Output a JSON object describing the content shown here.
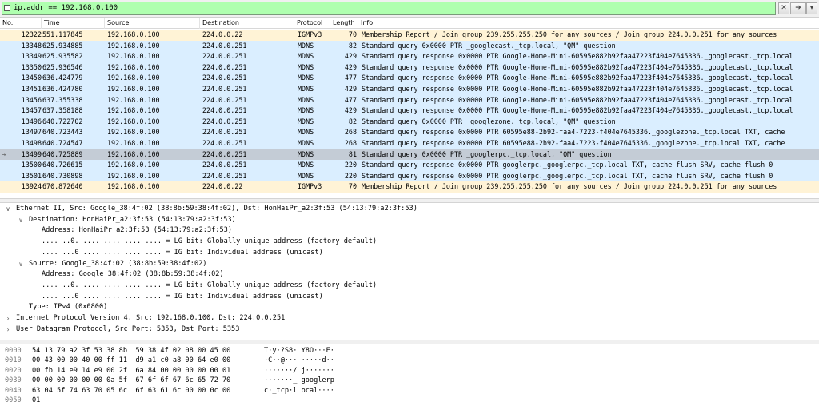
{
  "filter": {
    "value": "ip.addr == 192.168.0.100",
    "clear_label": "✕",
    "apply_label": "➔",
    "dropdown_label": "▾"
  },
  "columns": [
    "No.",
    "Time",
    "Source",
    "Destination",
    "Protocol",
    "Length",
    "Info"
  ],
  "packets": [
    {
      "no": "12322",
      "time": "551.117845",
      "src": "192.168.0.100",
      "dst": "224.0.0.22",
      "proto": "IGMPv3",
      "len": "70",
      "info": "Membership Report / Join group 239.255.255.250 for any sources / Join group 224.0.0.251 for any sources",
      "kind": "igmp"
    },
    {
      "no": "13348",
      "time": "625.934885",
      "src": "192.168.0.100",
      "dst": "224.0.0.251",
      "proto": "MDNS",
      "len": "82",
      "info": "Standard query 0x0000 PTR _googlecast._tcp.local, \"QM\" question",
      "kind": "mdns"
    },
    {
      "no": "13349",
      "time": "625.935582",
      "src": "192.168.0.100",
      "dst": "224.0.0.251",
      "proto": "MDNS",
      "len": "429",
      "info": "Standard query response 0x0000 PTR Google-Home-Mini-60595e882b92faa47223f404e7645336._googlecast._tcp.local",
      "kind": "mdns"
    },
    {
      "no": "13350",
      "time": "625.936546",
      "src": "192.168.0.100",
      "dst": "224.0.0.251",
      "proto": "MDNS",
      "len": "429",
      "info": "Standard query response 0x0000 PTR Google-Home-Mini-60595e882b92faa47223f404e7645336._googlecast._tcp.local",
      "kind": "mdns"
    },
    {
      "no": "13450",
      "time": "636.424779",
      "src": "192.168.0.100",
      "dst": "224.0.0.251",
      "proto": "MDNS",
      "len": "477",
      "info": "Standard query response 0x0000 PTR Google-Home-Mini-60595e882b92faa47223f404e7645336._googlecast._tcp.local",
      "kind": "mdns"
    },
    {
      "no": "13451",
      "time": "636.424780",
      "src": "192.168.0.100",
      "dst": "224.0.0.251",
      "proto": "MDNS",
      "len": "429",
      "info": "Standard query response 0x0000 PTR Google-Home-Mini-60595e882b92faa47223f404e7645336._googlecast._tcp.local",
      "kind": "mdns"
    },
    {
      "no": "13456",
      "time": "637.355338",
      "src": "192.168.0.100",
      "dst": "224.0.0.251",
      "proto": "MDNS",
      "len": "477",
      "info": "Standard query response 0x0000 PTR Google-Home-Mini-60595e882b92faa47223f404e7645336._googlecast._tcp.local",
      "kind": "mdns"
    },
    {
      "no": "13457",
      "time": "637.358188",
      "src": "192.168.0.100",
      "dst": "224.0.0.251",
      "proto": "MDNS",
      "len": "429",
      "info": "Standard query response 0x0000 PTR Google-Home-Mini-60595e882b92faa47223f404e7645336._googlecast._tcp.local",
      "kind": "mdns"
    },
    {
      "no": "13496",
      "time": "640.722702",
      "src": "192.168.0.100",
      "dst": "224.0.0.251",
      "proto": "MDNS",
      "len": "82",
      "info": "Standard query 0x0000 PTR _googlezone._tcp.local, \"QM\" question",
      "kind": "mdns"
    },
    {
      "no": "13497",
      "time": "640.723443",
      "src": "192.168.0.100",
      "dst": "224.0.0.251",
      "proto": "MDNS",
      "len": "268",
      "info": "Standard query response 0x0000 PTR 60595e88-2b92-faa4-7223-f404e7645336._googlezone._tcp.local TXT, cache",
      "kind": "mdns"
    },
    {
      "no": "13498",
      "time": "640.724547",
      "src": "192.168.0.100",
      "dst": "224.0.0.251",
      "proto": "MDNS",
      "len": "268",
      "info": "Standard query response 0x0000 PTR 60595e88-2b92-faa4-7223-f404e7645336._googlezone._tcp.local TXT, cache",
      "kind": "mdns"
    },
    {
      "no": "13499",
      "time": "640.725889",
      "src": "192.168.0.100",
      "dst": "224.0.0.251",
      "proto": "MDNS",
      "len": "81",
      "info": "Standard query 0x0000 PTR _googlerpc._tcp.local, \"QM\" question",
      "kind": "sel"
    },
    {
      "no": "13500",
      "time": "640.726615",
      "src": "192.168.0.100",
      "dst": "224.0.0.251",
      "proto": "MDNS",
      "len": "220",
      "info": "Standard query response 0x0000 PTR googlerpc._googlerpc._tcp.local TXT, cache flush SRV, cache flush 0",
      "kind": "mdns"
    },
    {
      "no": "13501",
      "time": "640.730898",
      "src": "192.168.0.100",
      "dst": "224.0.0.251",
      "proto": "MDNS",
      "len": "220",
      "info": "Standard query response 0x0000 PTR googlerpc._googlerpc._tcp.local TXT, cache flush SRV, cache flush 0",
      "kind": "mdns"
    },
    {
      "no": "13924",
      "time": "670.872640",
      "src": "192.168.0.100",
      "dst": "224.0.0.22",
      "proto": "IGMPv3",
      "len": "70",
      "info": "Membership Report / Join group 239.255.255.250 for any sources / Join group 224.0.0.251 for any sources",
      "kind": "igmp"
    }
  ],
  "details": [
    {
      "text": "Ethernet II, Src: Google_38:4f:02 (38:8b:59:38:4f:02), Dst: HonHaiPr_a2:3f:53 (54:13:79:a2:3f:53)",
      "level": 0,
      "arrow": "open"
    },
    {
      "text": "Destination: HonHaiPr_a2:3f:53 (54:13:79:a2:3f:53)",
      "level": 1,
      "arrow": "open"
    },
    {
      "text": "Address: HonHaiPr_a2:3f:53 (54:13:79:a2:3f:53)",
      "level": 2,
      "arrow": ""
    },
    {
      "text": ".... ..0. .... .... .... .... = LG bit: Globally unique address (factory default)",
      "level": 2,
      "arrow": ""
    },
    {
      "text": ".... ...0 .... .... .... .... = IG bit: Individual address (unicast)",
      "level": 2,
      "arrow": ""
    },
    {
      "text": "Source: Google_38:4f:02 (38:8b:59:38:4f:02)",
      "level": 1,
      "arrow": "open"
    },
    {
      "text": "Address: Google_38:4f:02 (38:8b:59:38:4f:02)",
      "level": 2,
      "arrow": ""
    },
    {
      "text": ".... ..0. .... .... .... .... = LG bit: Globally unique address (factory default)",
      "level": 2,
      "arrow": ""
    },
    {
      "text": ".... ...0 .... .... .... .... = IG bit: Individual address (unicast)",
      "level": 2,
      "arrow": ""
    },
    {
      "text": "Type: IPv4 (0x0800)",
      "level": 1,
      "arrow": ""
    },
    {
      "text": "Internet Protocol Version 4, Src: 192.168.0.100, Dst: 224.0.0.251",
      "level": 0,
      "arrow": "closed"
    },
    {
      "text": "User Datagram Protocol, Src Port: 5353, Dst Port: 5353",
      "level": 0,
      "arrow": "closed"
    }
  ],
  "bytes": [
    {
      "off": "0000",
      "hex": "54 13 79 a2 3f 53 38 8b  59 38 4f 02 08 00 45 00",
      "ascii": "T·y·?S8· Y8O···E·"
    },
    {
      "off": "0010",
      "hex": "00 43 00 00 40 00 ff 11  d9 a1 c0 a8 00 64 e0 00",
      "ascii": "·C··@··· ·····d··"
    },
    {
      "off": "0020",
      "hex": "00 fb 14 e9 14 e9 00 2f  6a 84 00 00 00 00 00 01",
      "ascii": "·······/ j·······"
    },
    {
      "off": "0030",
      "hex": "00 00 00 00 00 00 0a 5f  67 6f 6f 67 6c 65 72 70",
      "ascii": "·······_ googlerp"
    },
    {
      "off": "0040",
      "hex": "63 04 5f 74 63 70 05 6c  6f 63 61 6c 00 00 0c 00",
      "ascii": "c·_tcp·l ocal····"
    },
    {
      "off": "0050",
      "hex": "01",
      "ascii": ""
    }
  ]
}
